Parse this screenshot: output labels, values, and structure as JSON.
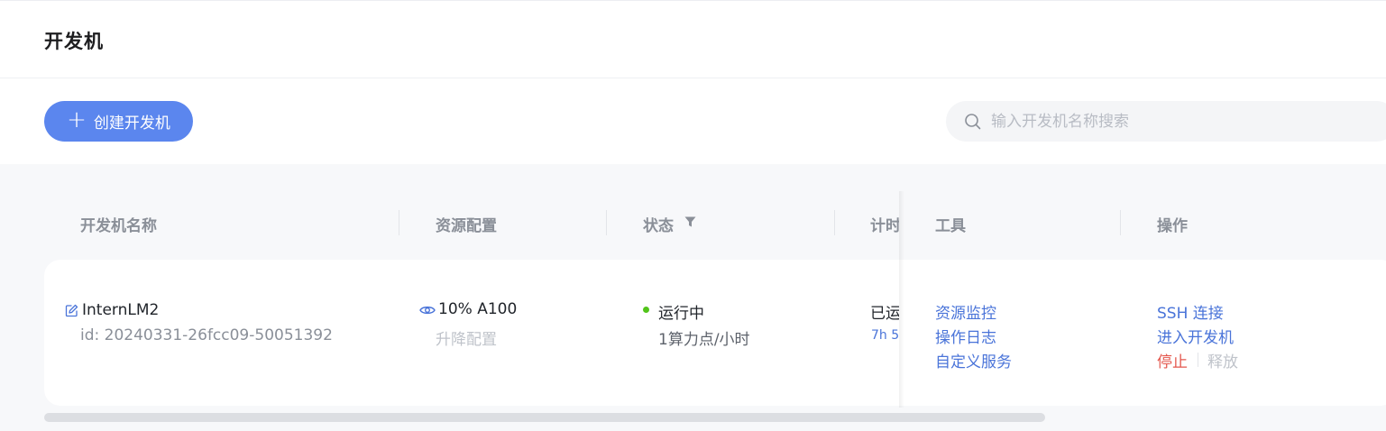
{
  "page": {
    "title": "开发机"
  },
  "toolbar": {
    "create_label": "创建开发机"
  },
  "search": {
    "placeholder": "输入开发机名称搜索",
    "value": ""
  },
  "table": {
    "columns": {
      "name": "开发机名称",
      "resource": "资源配置",
      "status": "状态",
      "timing": "计时",
      "tools": "工具",
      "actions": "操作"
    },
    "rows": [
      {
        "name": "InternLM2",
        "id": "id: 20240331-26fcc09-50051392",
        "resource": "10% A100",
        "resource_action": "升降配置",
        "status": "运行中",
        "status_color": "#52c41a",
        "cost": "1算力点/小时",
        "timing_status": "已运",
        "timing_value": "7h 5",
        "tools": [
          "资源监控",
          "操作日志",
          "自定义服务"
        ],
        "actions": {
          "ssh": "SSH 连接",
          "enter": "进入开发机",
          "stop": "停止",
          "release": "释放"
        }
      }
    ]
  },
  "colors": {
    "primary": "#5b86ee",
    "link": "#4a74d9",
    "danger": "#e4574d"
  }
}
